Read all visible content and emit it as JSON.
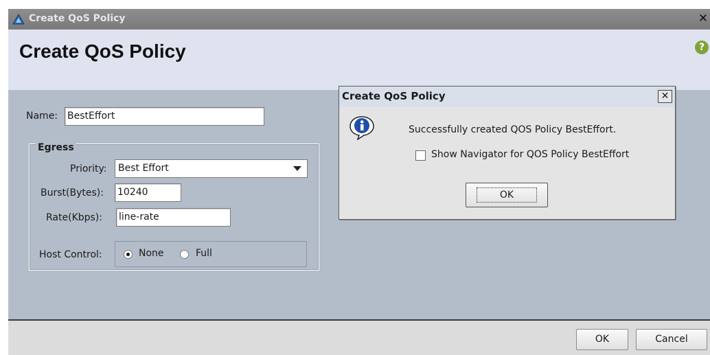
{
  "window": {
    "title": "Create QoS Policy",
    "close_glyph": "✕",
    "icon": "network-triangle-icon"
  },
  "header": {
    "title": "Create QoS Policy",
    "help_glyph": "?"
  },
  "form": {
    "name_label": "Name:",
    "name_value": "BestEffort",
    "egress_legend": "Egress",
    "priority_label": "Priority:",
    "priority_value": "Best Effort",
    "burst_label": "Burst(Bytes):",
    "burst_value": "10240",
    "rate_label": "Rate(Kbps):",
    "rate_value": "line-rate",
    "host_control_label": "Host Control:",
    "host_control_options": [
      {
        "label": "None",
        "checked": true
      },
      {
        "label": "Full",
        "checked": false
      }
    ]
  },
  "footer": {
    "ok_label": "OK",
    "cancel_label": "Cancel"
  },
  "dialog": {
    "title": "Create QoS Policy",
    "close_glyph": "✕",
    "icon": "info-icon",
    "message": "Successfully created QOS Policy BestEffort.",
    "checkbox_label": "Show Navigator for QOS Policy BestEffort",
    "checkbox_checked": false,
    "ok_label": "OK"
  },
  "colors": {
    "panel_bg": "#b3bdc9",
    "header_bg": "#dfe3ef",
    "titlebar_bg": "#7a7a7a",
    "help_green": "#7fa33a"
  }
}
